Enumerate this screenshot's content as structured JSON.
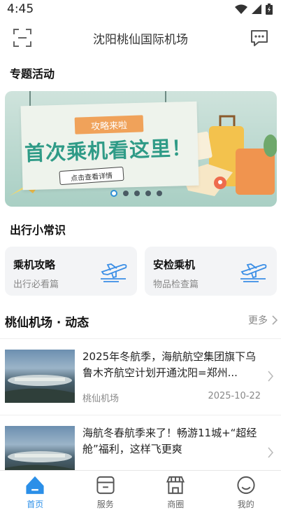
{
  "status_bar": {
    "time": "4:45"
  },
  "header": {
    "title": "沈阳桃仙国际机场"
  },
  "sections": {
    "special_title": "专题活动",
    "tips_title": "出行小常识"
  },
  "banner": {
    "tag": "攻略来啦",
    "headline": "首次乘机看这里！",
    "cta": "点击查看详情",
    "dot_count": 5,
    "active_dot": 0
  },
  "tip_cards": [
    {
      "title": "乘机攻略",
      "subtitle": "出行必看篇"
    },
    {
      "title": "安检乘机",
      "subtitle": "物品检查篇"
    }
  ],
  "news": {
    "title": "桃仙机场 · 动态",
    "more": "更多",
    "items": [
      {
        "headline": "2025年冬航季，海航航空集团旗下乌鲁木齐航空计划开通沈阳=郑州...",
        "source": "桃仙机场",
        "date": "2025-10-22"
      },
      {
        "headline": "海航冬春航季来了！畅游11城+“超经舱”福利，这样飞更爽",
        "source": "",
        "date": ""
      }
    ]
  },
  "tabs": [
    {
      "label": "首页",
      "icon": "home-icon",
      "active": true
    },
    {
      "label": "服务",
      "icon": "service-icon",
      "active": false
    },
    {
      "label": "商圈",
      "icon": "shop-icon",
      "active": false
    },
    {
      "label": "我的",
      "icon": "profile-icon",
      "active": false
    }
  ],
  "colors": {
    "accent": "#2b8fe8",
    "banner_green": "#2f9b87",
    "tag_orange": "#f0a25a"
  }
}
